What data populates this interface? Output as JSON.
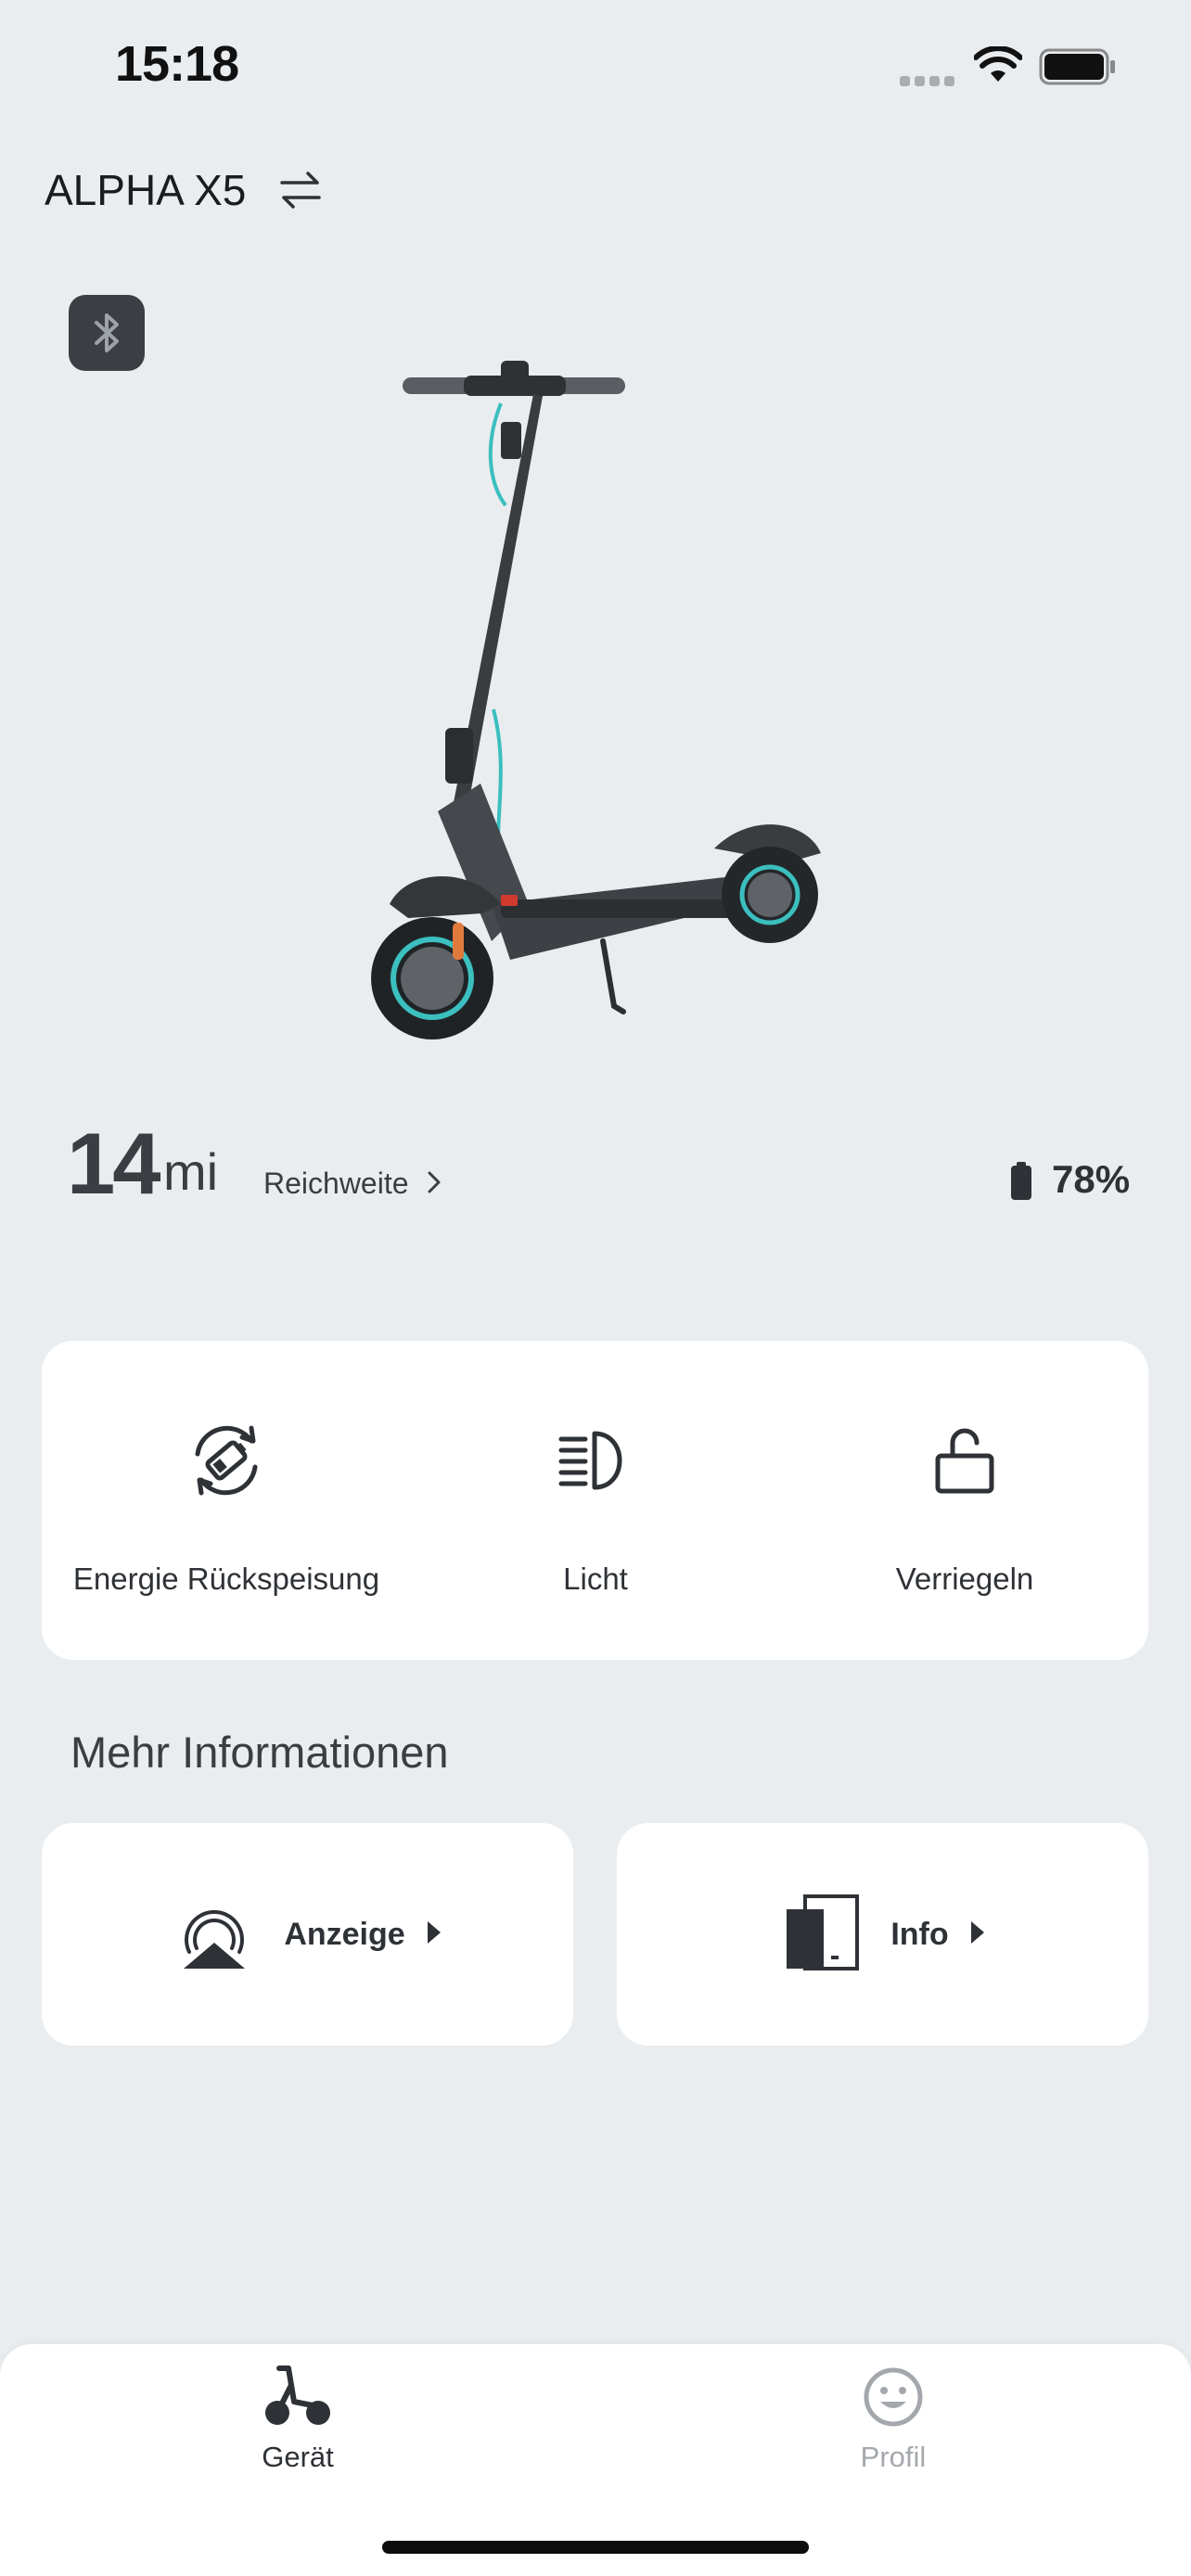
{
  "status_bar": {
    "time": "15:18"
  },
  "header": {
    "device_name": "ALPHA X5",
    "swap_icon": "swap-arrows-icon"
  },
  "bluetooth": {
    "icon": "bluetooth-icon"
  },
  "range": {
    "value": "14",
    "unit": "mi",
    "label": "Reichweite"
  },
  "battery": {
    "percent_label": "78%",
    "level": 0.78
  },
  "controls": [
    {
      "label": "Energie Rückspeisung",
      "icon": "energy-recovery-icon"
    },
    {
      "label": "Licht",
      "icon": "headlight-icon"
    },
    {
      "label": "Verriegeln",
      "icon": "unlock-icon"
    }
  ],
  "more_info": {
    "title": "Mehr Informationen",
    "tiles": [
      {
        "label": "Anzeige",
        "icon": "display-icon"
      },
      {
        "label": "Info",
        "icon": "info-device-icon"
      }
    ]
  },
  "tabs": [
    {
      "label": "Gerät",
      "icon": "scooter-icon",
      "active": true
    },
    {
      "label": "Profil",
      "icon": "smiley-icon",
      "active": false
    }
  ],
  "colors": {
    "accent_teal": "#3bbfbf",
    "dark": "#2e3236",
    "inactive": "#a4a8ad",
    "background": "#eaedf0"
  }
}
